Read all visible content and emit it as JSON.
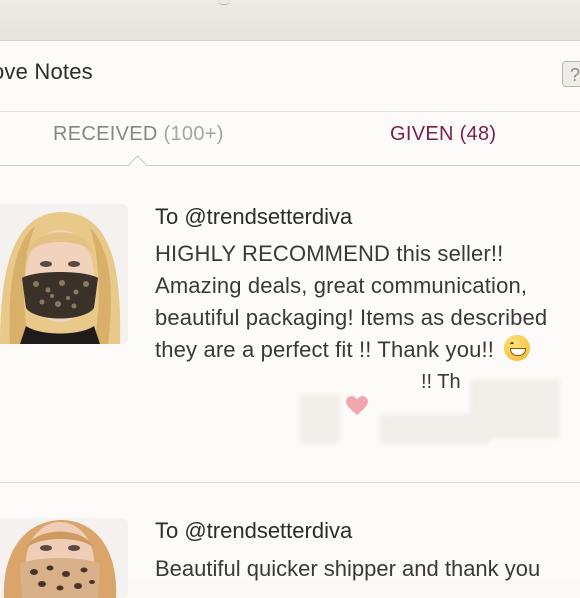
{
  "header": {
    "title": "ove Notes",
    "help_label": "?"
  },
  "tabs": {
    "received": {
      "label": "RECEIVED",
      "count": "(100+)"
    },
    "given": {
      "label": "GIVEN (48)"
    }
  },
  "notes": [
    {
      "recipient": "To @trendsetterdiva",
      "lines": [
        "HIGHLY RECOMMEND this seller!!",
        "Amazing deals, great communication,",
        "beautiful packaging! Items as described",
        "they are a perfect fit !! Thank you!!"
      ],
      "fragment": "!! Th",
      "emoji": "grinning-face-emoji",
      "thumbnail": "snake-print-mask-photo"
    },
    {
      "recipient": "To @trendsetterdiva",
      "body": "Beautiful quicker shipper and thank you",
      "thumbnail": "leopard-print-mask-photo"
    }
  ],
  "colors": {
    "accent_given": "#7a1f4a",
    "tab_inactive": "#8a8580",
    "background": "#fdfbf9"
  }
}
